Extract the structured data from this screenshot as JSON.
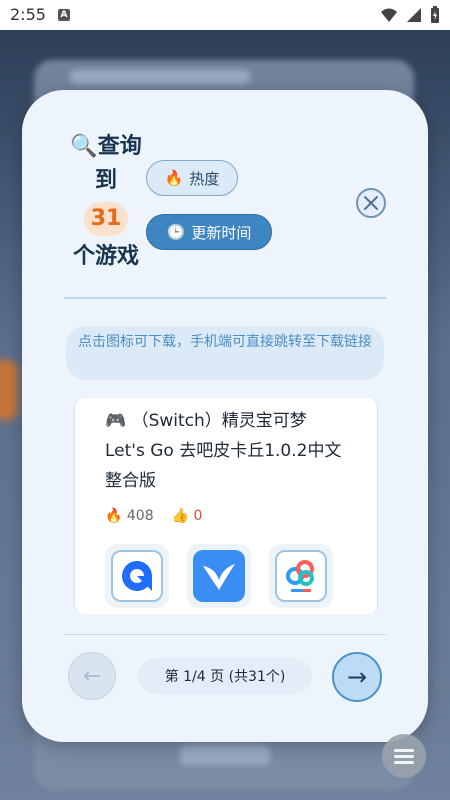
{
  "status_bar": {
    "time": "2:55",
    "notification_badge": "A"
  },
  "header": {
    "search_emoji": "🔍",
    "title_prefix": "查询",
    "title_to": "到",
    "count": "31",
    "title_suffix": "个游戏",
    "sort_hot_label": "热度",
    "sort_hot_emoji": "🔥",
    "sort_time_label": "更新时间",
    "sort_time_emoji": "🕒"
  },
  "notice": "点击图标可下载，手机端可直接跳转至下载链接",
  "game": {
    "emoji": "🎮",
    "title": "（Switch）精灵宝可梦 Let's Go 去吧皮卡丘1.0.2中文整合版",
    "hot_emoji": "🔥",
    "hot_count": "408",
    "like_emoji": "👍",
    "like_count": "0",
    "download_icons": [
      "quark-drive-icon",
      "xunlei-icon",
      "baidu-netdisk-icon"
    ]
  },
  "pagination": {
    "text": "第 1/4 页 (共31个)",
    "prev_symbol": "←",
    "next_symbol": "→"
  },
  "colors": {
    "accent": "#3d86c2",
    "title": "#17354f",
    "count_bg": "#fde0cc",
    "count_text": "#e46a1c",
    "notice_text": "#4a8fc5",
    "like": "#e04646"
  }
}
